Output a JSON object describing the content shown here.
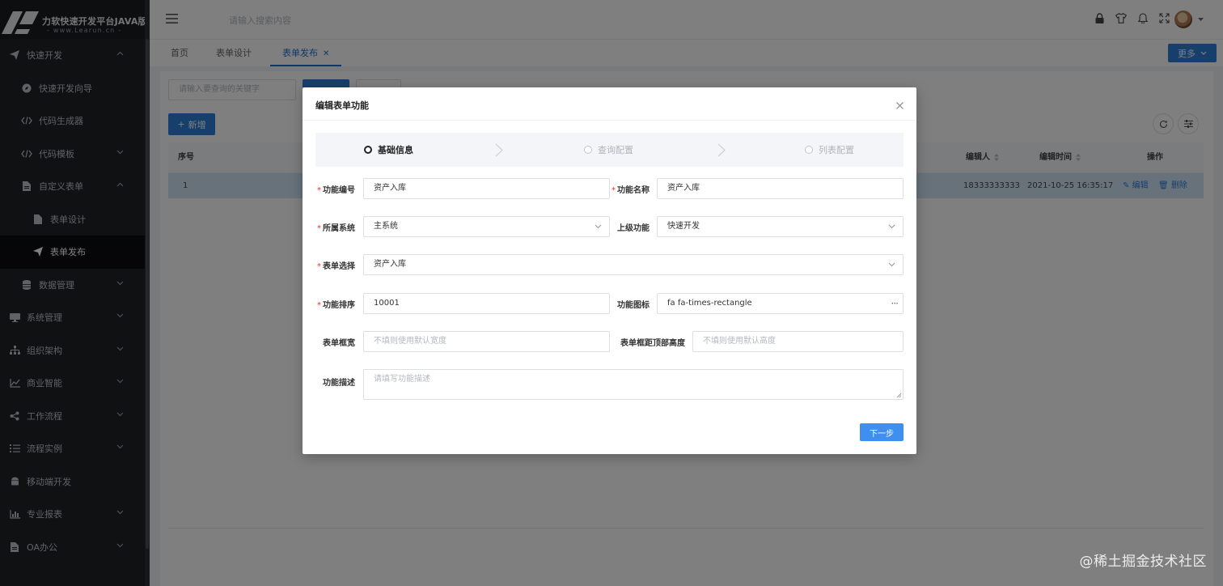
{
  "brand": {
    "name": "力软快速开发平台JAVA版",
    "url": "- www.Learun.cn -"
  },
  "sidebar": {
    "items": [
      {
        "label": "快速开发",
        "icon": "paper-plane-icon",
        "expanded": true
      },
      {
        "label": "快速开发向导",
        "icon": "compass-icon"
      },
      {
        "label": "代码生成器",
        "icon": "code-icon"
      },
      {
        "label": "代码模板",
        "icon": "code-icon",
        "expanded": false
      },
      {
        "label": "自定义表单",
        "icon": "file-icon",
        "expanded": true
      },
      {
        "label": "表单设计",
        "icon": "file-icon"
      },
      {
        "label": "表单发布",
        "icon": "paper-plane-icon",
        "active": true
      },
      {
        "label": "数据管理",
        "icon": "database-icon",
        "expanded": false
      },
      {
        "label": "系统管理",
        "icon": "desktop-icon",
        "expanded": false
      },
      {
        "label": "组织架构",
        "icon": "sitemap-icon",
        "expanded": false
      },
      {
        "label": "商业智能",
        "icon": "line-chart-icon",
        "expanded": false
      },
      {
        "label": "工作流程",
        "icon": "share-alt-icon",
        "expanded": false
      },
      {
        "label": "流程实例",
        "icon": "list-icon",
        "expanded": false
      },
      {
        "label": "移动端开发",
        "icon": "android-icon"
      },
      {
        "label": "专业报表",
        "icon": "bar-chart-icon",
        "expanded": false
      },
      {
        "label": "OA办公",
        "icon": "file-text-icon",
        "expanded": false
      }
    ]
  },
  "header": {
    "search_placeholder": "请输入搜索内容"
  },
  "tabs": [
    {
      "label": "首页"
    },
    {
      "label": "表单设计"
    },
    {
      "label": "表单发布",
      "active": true
    }
  ],
  "tabbar": {
    "more_label": "更多"
  },
  "content": {
    "search_placeholder": "请输入要查询的关键字",
    "add_label": "新增",
    "table": {
      "headers": {
        "index": "序号",
        "editor": "编辑人",
        "edit_time": "编辑时间",
        "actions": "操作"
      },
      "rows": [
        {
          "index": "1",
          "editor": "18333333333",
          "edit_time": "2021-10-25 16:35:17",
          "edit": "编辑",
          "delete": "删除"
        }
      ]
    }
  },
  "modal": {
    "title": "编辑表单功能",
    "steps": [
      {
        "label": "基础信息",
        "active": true
      },
      {
        "label": "查询配置"
      },
      {
        "label": "列表配置"
      }
    ],
    "fields": {
      "code": {
        "label": "功能编号",
        "required": true,
        "value": "资产入库"
      },
      "name": {
        "label": "功能名称",
        "required": true,
        "value": "资产入库"
      },
      "system": {
        "label": "所属系统",
        "required": true,
        "value": "主系统"
      },
      "parent": {
        "label": "上级功能",
        "required": false,
        "value": "快速开发"
      },
      "form": {
        "label": "表单选择",
        "required": true,
        "value": "资产入库"
      },
      "sort": {
        "label": "功能排序",
        "required": true,
        "value": "10001"
      },
      "icon": {
        "label": "功能图标",
        "required": false,
        "value": "fa fa-times-rectangle"
      },
      "width": {
        "label": "表单框宽",
        "required": false,
        "placeholder": "不填则使用默认宽度"
      },
      "top": {
        "label": "表单框距顶部高度",
        "required": false,
        "placeholder": "不填则使用默认高度"
      },
      "desc": {
        "label": "功能描述",
        "required": false,
        "placeholder": "请填写功能描述"
      }
    },
    "next_label": "下一步"
  },
  "watermark": "@稀土掘金技术社区",
  "colors": {
    "primary": "#2f7ed8",
    "sidebar_bg": "#202227",
    "required": "#e0312f",
    "row_selected": "#cfe4f7"
  }
}
